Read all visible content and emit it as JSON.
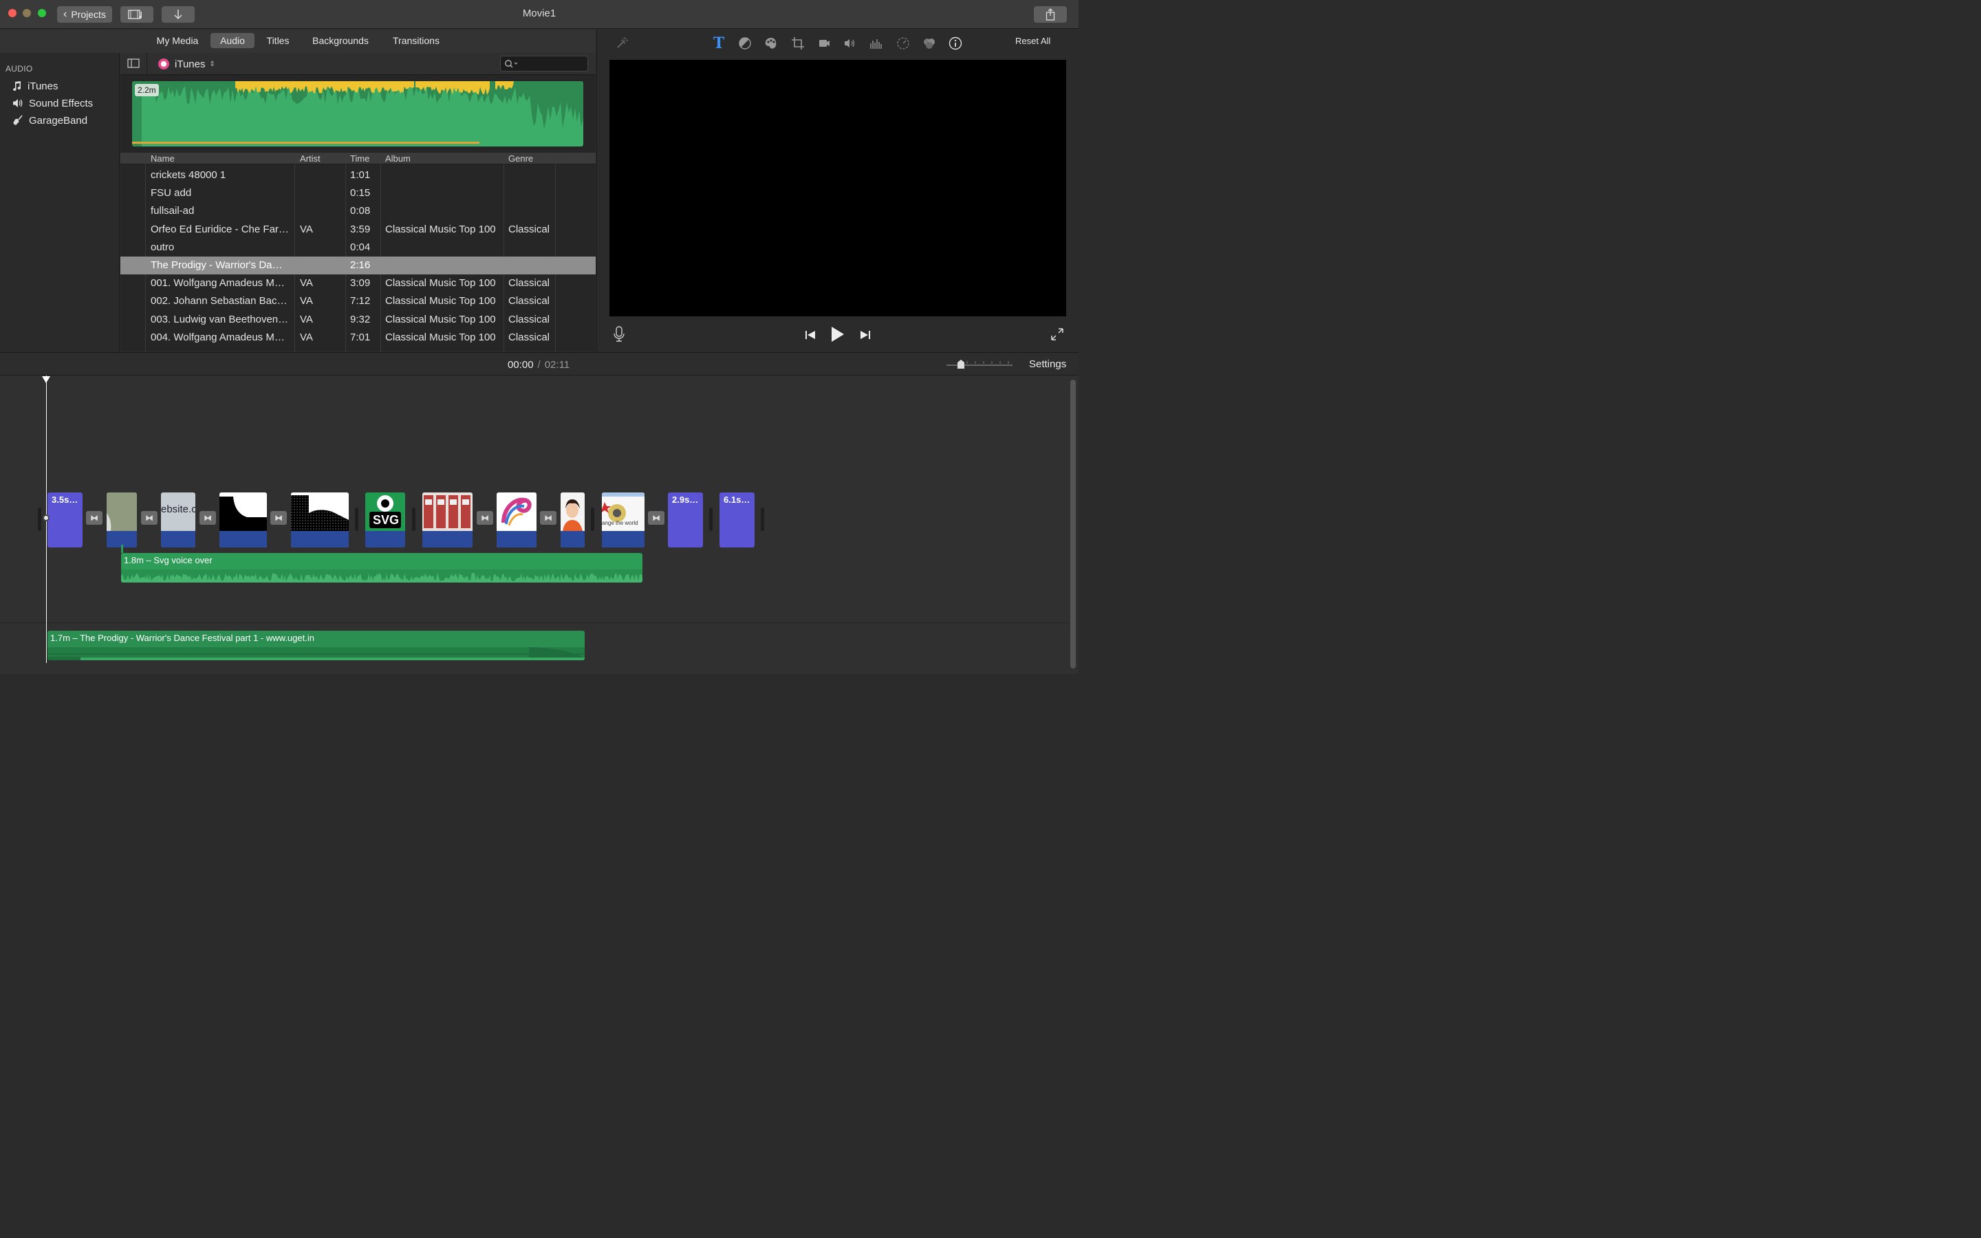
{
  "window": {
    "title": "Movie1",
    "back_label": "Projects"
  },
  "media_tabs": [
    {
      "label": "My Media"
    },
    {
      "label": "Audio"
    },
    {
      "label": "Titles"
    },
    {
      "label": "Backgrounds"
    },
    {
      "label": "Transitions"
    }
  ],
  "sidebar": {
    "heading": "AUDIO",
    "items": [
      {
        "label": "iTunes",
        "icon": "music-note-icon"
      },
      {
        "label": "Sound Effects",
        "icon": "speaker-icon"
      },
      {
        "label": "GarageBand",
        "icon": "guitar-icon"
      }
    ]
  },
  "browser": {
    "source_label": "iTunes",
    "search": {
      "placeholder": ""
    },
    "waveform_badge": "2.2m",
    "columns": [
      "Name",
      "Artist",
      "Time",
      "Album",
      "Genre"
    ],
    "rows": [
      {
        "name": "crickets 48000 1",
        "artist": "",
        "time": "1:01",
        "album": "",
        "genre": ""
      },
      {
        "name": "FSU add",
        "artist": "",
        "time": "0:15",
        "album": "",
        "genre": ""
      },
      {
        "name": "fullsail-ad",
        "artist": "",
        "time": "0:08",
        "album": "",
        "genre": ""
      },
      {
        "name": "Orfeo Ed Euridice - Che Far…",
        "artist": "VA",
        "time": "3:59",
        "album": "Classical Music Top 100",
        "genre": "Classical"
      },
      {
        "name": "outro",
        "artist": "",
        "time": "0:04",
        "album": "",
        "genre": ""
      },
      {
        "name": "The Prodigy - Warrior's Da…",
        "artist": "",
        "time": "2:16",
        "album": "",
        "genre": ""
      },
      {
        "name": "001. Wolfgang Amadeus M…",
        "artist": "VA",
        "time": "3:09",
        "album": "Classical Music Top 100",
        "genre": "Classical"
      },
      {
        "name": "002. Johann Sebastian Bac…",
        "artist": "VA",
        "time": "7:12",
        "album": "Classical Music Top 100",
        "genre": "Classical"
      },
      {
        "name": "003. Ludwig van Beethoven…",
        "artist": "VA",
        "time": "9:32",
        "album": "Classical Music Top 100",
        "genre": "Classical"
      },
      {
        "name": "004. Wolfgang Amadeus M…",
        "artist": "VA",
        "time": "7:01",
        "album": "Classical Music Top 100",
        "genre": "Classical"
      }
    ],
    "selected_row": 5
  },
  "viewer": {
    "reset_label": "Reset All"
  },
  "timeline": {
    "current_time": "00:00",
    "separator": "/",
    "total_time": "02:11",
    "settings_label": "Settings",
    "clips": [
      {
        "kind": "title",
        "label": "3.5s…"
      },
      {
        "kind": "video",
        "label": ""
      },
      {
        "kind": "video",
        "label": "ebsite.c"
      },
      {
        "kind": "video",
        "label": ""
      },
      {
        "kind": "video",
        "label": ""
      },
      {
        "kind": "video",
        "label": "SVG"
      },
      {
        "kind": "video",
        "label": ""
      },
      {
        "kind": "video",
        "label": ""
      },
      {
        "kind": "video",
        "label": ""
      },
      {
        "kind": "video",
        "label": "ange the world"
      },
      {
        "kind": "title",
        "label": "2.9s…"
      },
      {
        "kind": "title",
        "label": "6.1s…"
      }
    ],
    "voiceover_label": "1.8m – Svg voice over",
    "music_label": "1.7m – The Prodigy - Warrior's Dance Festival part 1 - www.uget.in"
  },
  "colors": {
    "accent_blue": "#3b8ff0",
    "title_clip": "#5b55d6",
    "audio_green": "#2d9d57",
    "waveform_yellow": "#f2c233"
  }
}
